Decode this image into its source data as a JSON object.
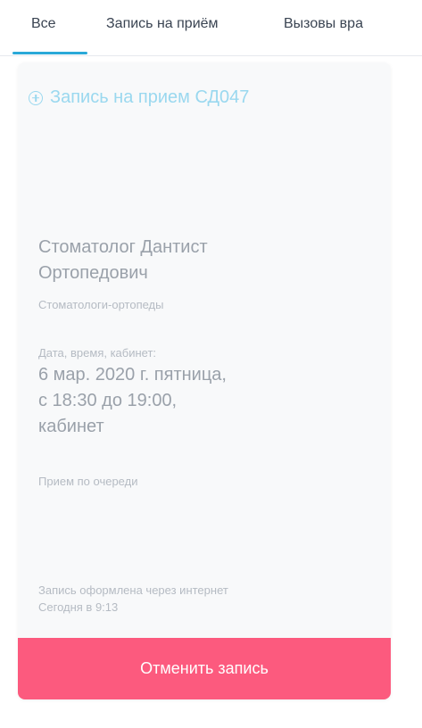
{
  "tabs": [
    {
      "label": "Все"
    },
    {
      "label": "Запись на приём"
    },
    {
      "label": "Вызовы вра"
    }
  ],
  "card": {
    "title": "Запись на прием СД047",
    "doctor_name_line1": "Стоматолог Дантист",
    "doctor_name_line2": "Ортопедович",
    "specialty": "Стоматологи-ортопеды",
    "datetime_label": "Дата, время, кабинет:",
    "datetime_line1": "6 мар. 2020 г. пятница,",
    "datetime_line2": "с 18:30 до 19:00,",
    "datetime_line3": "кабинет",
    "queue_note": "Прием по очереди",
    "source_note": "Запись оформлена через интернет",
    "created_time": "Сегодня в 9:13",
    "cancel_label": "Отменить запись"
  },
  "colors": {
    "accent": "#2aa9d8",
    "title_light": "#9ad8ef",
    "cancel": "#fc5a7e"
  },
  "icons": {
    "title_icon": "plus-circle-icon"
  }
}
